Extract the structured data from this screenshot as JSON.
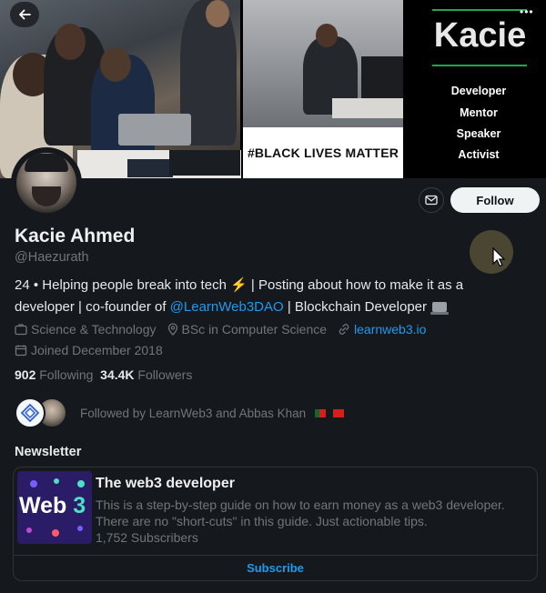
{
  "banner": {
    "name": "Kacie",
    "roles": [
      "Developer",
      "Mentor",
      "Speaker",
      "Activist"
    ],
    "sign_text": "#BLACK LIVES MATTER",
    "more_glyph": "•••"
  },
  "actions": {
    "follow_label": "Follow"
  },
  "profile": {
    "display_name": "Kacie Ahmed",
    "handle": "@Haezurath",
    "bio_part1": "24 • Helping people break into tech ⚡ | Posting about how to make it as a developer | co-founder of ",
    "bio_mention": "@LearnWeb3DAO",
    "bio_part2": " | Blockchain Developer ",
    "category": "Science & Technology",
    "location": "BSc in Computer Science",
    "website": "learnweb3.io",
    "joined": "Joined December 2018",
    "following_count": "902",
    "following_label": "Following",
    "followers_count": "34.4K",
    "followers_label": "Followers",
    "followed_by": "Followed by LearnWeb3 and Abbas Khan"
  },
  "newsletter": {
    "section_title": "Newsletter",
    "thumb_text_a": "Web",
    "thumb_text_b": "3",
    "name": "The web3 developer",
    "description": "This is a step-by-step guide on how to earn money as a web3 developer. There are no \"short-cuts\" in this guide. Just actionable tips.",
    "subscribers": "1,752 Subscribers",
    "subscribe_label": "Subscribe"
  }
}
